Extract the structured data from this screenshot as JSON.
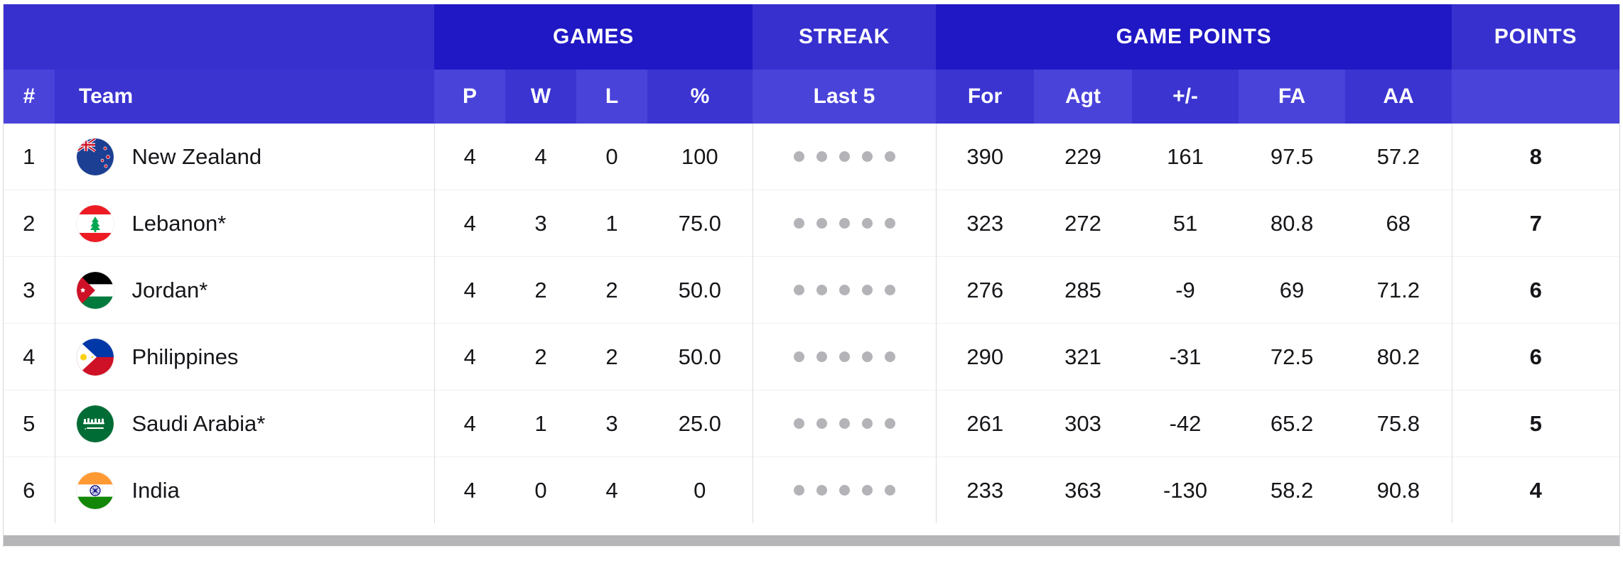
{
  "table": {
    "group_headers": [
      {
        "label": "",
        "name": "group-blank",
        "span": 2
      },
      {
        "label": "GAMES",
        "name": "group-games",
        "span": 4
      },
      {
        "label": "STREAK",
        "name": "group-streak",
        "span": 1
      },
      {
        "label": "GAME POINTS",
        "name": "group-game-points",
        "span": 5
      },
      {
        "label": "POINTS",
        "name": "group-points",
        "span": 1
      }
    ],
    "columns": [
      {
        "key": "rank",
        "label": "#"
      },
      {
        "key": "team",
        "label": "Team"
      },
      {
        "key": "p",
        "label": "P"
      },
      {
        "key": "w",
        "label": "W"
      },
      {
        "key": "l",
        "label": "L"
      },
      {
        "key": "pct",
        "label": "%"
      },
      {
        "key": "last5",
        "label": "Last 5"
      },
      {
        "key": "for",
        "label": "For"
      },
      {
        "key": "agt",
        "label": "Agt"
      },
      {
        "key": "diff",
        "label": "+/-"
      },
      {
        "key": "fa",
        "label": "FA"
      },
      {
        "key": "aa",
        "label": "AA"
      },
      {
        "key": "points",
        "label": ""
      }
    ],
    "rows": [
      {
        "rank": "1",
        "team": "New Zealand",
        "flag": "new-zealand-flag",
        "p": "4",
        "w": "4",
        "l": "0",
        "pct": "100",
        "last5": 5,
        "for": "390",
        "agt": "229",
        "diff": "161",
        "fa": "97.5",
        "aa": "57.2",
        "points": "8"
      },
      {
        "rank": "2",
        "team": "Lebanon*",
        "flag": "lebanon-flag",
        "p": "4",
        "w": "3",
        "l": "1",
        "pct": "75.0",
        "last5": 5,
        "for": "323",
        "agt": "272",
        "diff": "51",
        "fa": "80.8",
        "aa": "68",
        "points": "7"
      },
      {
        "rank": "3",
        "team": "Jordan*",
        "flag": "jordan-flag",
        "p": "4",
        "w": "2",
        "l": "2",
        "pct": "50.0",
        "last5": 5,
        "for": "276",
        "agt": "285",
        "diff": "-9",
        "fa": "69",
        "aa": "71.2",
        "points": "6"
      },
      {
        "rank": "4",
        "team": "Philippines",
        "flag": "philippines-flag",
        "p": "4",
        "w": "2",
        "l": "2",
        "pct": "50.0",
        "last5": 5,
        "for": "290",
        "agt": "321",
        "diff": "-31",
        "fa": "72.5",
        "aa": "80.2",
        "points": "6"
      },
      {
        "rank": "5",
        "team": "Saudi Arabia*",
        "flag": "saudi-arabia-flag",
        "p": "4",
        "w": "1",
        "l": "3",
        "pct": "25.0",
        "last5": 5,
        "for": "261",
        "agt": "303",
        "diff": "-42",
        "fa": "65.2",
        "aa": "75.8",
        "points": "5"
      },
      {
        "rank": "6",
        "team": "India",
        "flag": "india-flag",
        "p": "4",
        "w": "0",
        "l": "4",
        "pct": "0",
        "last5": 5,
        "for": "233",
        "agt": "363",
        "diff": "-130",
        "fa": "58.2",
        "aa": "90.8",
        "points": "4"
      }
    ]
  },
  "colors": {
    "header_group_dark": "#2018c4",
    "header_group_light": "#3730ce",
    "subheader_light": "#4a43da",
    "subheader_dark": "#3b34d1",
    "streak_dot": "#b4b4b8",
    "text": "#16161a"
  }
}
